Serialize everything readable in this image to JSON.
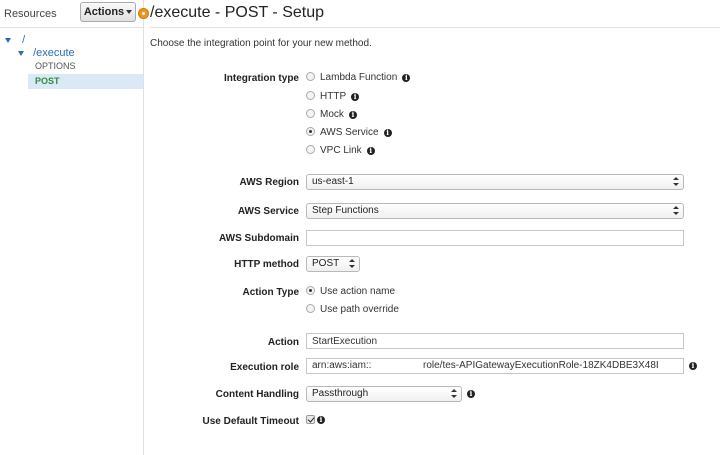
{
  "sidebar": {
    "title": "Resources",
    "actions_label": "Actions",
    "tree": {
      "root": "/",
      "child": "/execute",
      "methods": [
        "OPTIONS",
        "POST"
      ]
    }
  },
  "header": {
    "title": "/execute - POST - Setup"
  },
  "intro": "Choose the integration point for your new method.",
  "form": {
    "integration_type": {
      "label": "Integration type",
      "options": [
        "Lambda Function",
        "HTTP",
        "Mock",
        "AWS Service",
        "VPC Link"
      ],
      "selected": "AWS Service"
    },
    "aws_region": {
      "label": "AWS Region",
      "value": "us-east-1"
    },
    "aws_service": {
      "label": "AWS Service",
      "value": "Step Functions"
    },
    "aws_subdomain": {
      "label": "AWS Subdomain",
      "value": ""
    },
    "http_method": {
      "label": "HTTP method",
      "value": "POST"
    },
    "action_type": {
      "label": "Action Type",
      "options": [
        "Use action name",
        "Use path override"
      ],
      "selected": "Use action name"
    },
    "action": {
      "label": "Action",
      "value": "StartExecution"
    },
    "execution_role": {
      "label": "Execution role",
      "value_prefix": "arn:aws:iam::",
      "value_suffix": "role/tes-APIGatewayExecutionRole-18ZK4DBE3X48I"
    },
    "content_handling": {
      "label": "Content Handling",
      "value": "Passthrough"
    },
    "default_timeout": {
      "label": "Use Default Timeout",
      "checked": true
    }
  },
  "colors": {
    "link_blue": "#2a6eb5",
    "post_green": "#2e8b3c",
    "selected_row_bg": "#dbe9f7",
    "status_orange": "#f0961e"
  }
}
